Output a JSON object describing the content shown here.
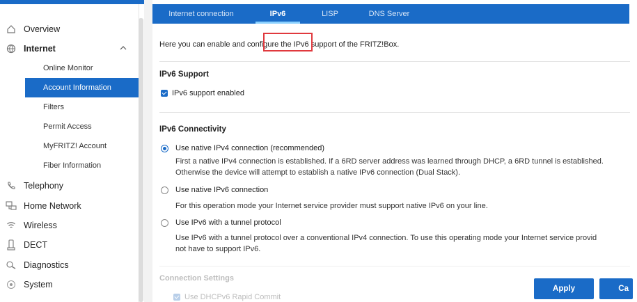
{
  "sidebar": {
    "items": [
      {
        "label": "Overview",
        "icon": "home-icon"
      },
      {
        "label": "Internet",
        "icon": "globe-icon"
      },
      {
        "label": "Online Monitor"
      },
      {
        "label": "Account Information"
      },
      {
        "label": "Filters"
      },
      {
        "label": "Permit Access"
      },
      {
        "label": "MyFRITZ! Account"
      },
      {
        "label": "Fiber Information"
      },
      {
        "label": "Telephony",
        "icon": "phone-icon"
      },
      {
        "label": "Home Network",
        "icon": "network-icon"
      },
      {
        "label": "Wireless",
        "icon": "wifi-icon"
      },
      {
        "label": "DECT",
        "icon": "dect-phone-icon"
      },
      {
        "label": "Diagnostics",
        "icon": "diagnostics-icon"
      },
      {
        "label": "System",
        "icon": "system-icon"
      }
    ]
  },
  "tabs": [
    {
      "label": "Internet connection"
    },
    {
      "label": "IPv6"
    },
    {
      "label": "LISP"
    },
    {
      "label": "DNS Server"
    }
  ],
  "main": {
    "intro": "Here you can enable and configure the IPv6 support of the FRITZ!Box.",
    "support_title": "IPv6 Support",
    "support_checkbox": "IPv6 support enabled",
    "connectivity_title": "IPv6 Connectivity",
    "options": [
      {
        "label": "Use native IPv4 connection (recommended)",
        "desc1": "First a native IPv4 connection is established. If a 6RD server address was learned through DHCP, a 6RD tunnel is established.",
        "desc2": "Otherwise the device will attempt to establish a native IPv6 connection (Dual Stack)."
      },
      {
        "label": "Use native IPv6 connection",
        "desc1": "For this operation mode your Internet service provider must support native IPv6 on your line."
      },
      {
        "label": "Use IPv6 with a tunnel protocol",
        "desc1": "Use IPv6 with a tunnel protocol over a conventional IPv4 connection. To use this operating mode your Internet service provid",
        "desc2": "not have to support IPv6."
      }
    ],
    "connection_settings_title": "Connection Settings",
    "rapid_commit": "Use DHCPv6 Rapid Commit"
  },
  "buttons": {
    "apply": "Apply",
    "cancel": "Ca"
  },
  "colors": {
    "accent": "#1a6bc7",
    "highlight": "#e0393e"
  }
}
